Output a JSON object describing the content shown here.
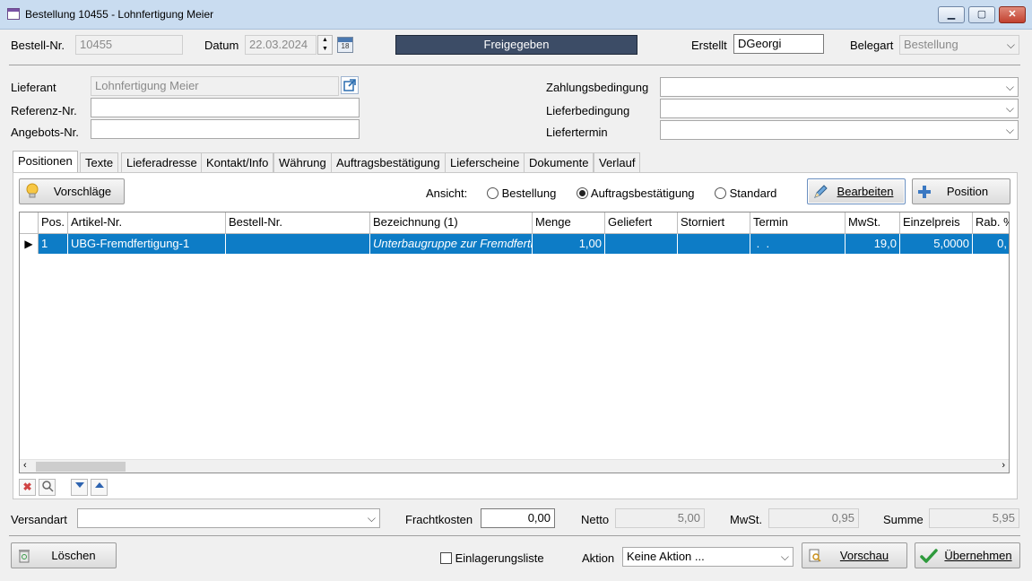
{
  "window": {
    "title": "Bestellung 10455 - Lohnfertigung Meier",
    "controls": {
      "minimize": "▁",
      "maximize": "▢",
      "close": "✕"
    }
  },
  "header": {
    "bestell_nr_label": "Bestell-Nr.",
    "bestell_nr_value": "10455",
    "datum_label": "Datum",
    "datum_value": "22.03.2024",
    "status": "Freigegeben",
    "erstellt_label": "Erstellt",
    "erstellt_value": "DGeorgi",
    "belegart_label": "Belegart",
    "belegart_value": "Bestellung"
  },
  "form": {
    "lieferant_label": "Lieferant",
    "lieferant_value": "Lohnfertigung Meier",
    "referenz_label": "Referenz-Nr.",
    "referenz_value": "",
    "angebots_label": "Angebots-Nr.",
    "angebots_value": "",
    "zahlung_label": "Zahlungsbedingung",
    "zahlung_value": "",
    "lieferbed_label": "Lieferbedingung",
    "lieferbed_value": "",
    "liefertermin_label": "Liefertermin",
    "liefertermin_value": ""
  },
  "tabs": [
    "Positionen",
    "Texte",
    "Lieferadresse",
    "Kontakt/Info",
    "Währung",
    "Auftragsbestätigung",
    "Lieferscheine",
    "Dokumente",
    "Verlauf"
  ],
  "toolbar": {
    "vorschlaege": "Vorschläge",
    "ansicht_label": "Ansicht:",
    "radio_bestellung": "Bestellung",
    "radio_auftrag": "Auftragsbestätigung",
    "radio_standard": "Standard",
    "selected_view": "Auftragsbestätigung",
    "bearbeiten": "Bearbeiten",
    "position": "Position"
  },
  "grid": {
    "columns": [
      "Pos.",
      "Artikel-Nr.",
      "Bestell-Nr.",
      "Bezeichnung (1)",
      "Menge",
      "Geliefert",
      "Storniert",
      "Termin",
      "MwSt.",
      "Einzelpreis",
      "Rab. %"
    ],
    "rows": [
      [
        "1",
        "UBG-Fremdfertigung-1",
        "",
        "Unterbaugruppe zur Fremdfertigung",
        "1,00",
        "",
        "",
        " .  .",
        "19,0",
        "5,0000",
        "0,"
      ]
    ],
    "row_marker": "▶"
  },
  "footer": {
    "versandart_label": "Versandart",
    "versandart_value": "",
    "frachtkosten_label": "Frachtkosten",
    "frachtkosten_value": "0,00",
    "netto_label": "Netto",
    "netto_value": "5,00",
    "mwst_label": "MwSt.",
    "mwst_value": "0,95",
    "summe_label": "Summe",
    "summe_value": "5,95",
    "loeschen": "Löschen",
    "einlagerung_label": "Einlagerungsliste",
    "aktion_label": "Aktion",
    "aktion_value": "Keine Aktion ...",
    "vorschau": "Vorschau",
    "uebernehmen": "Übernehmen"
  },
  "colors": {
    "status_bg": "#3c4c66",
    "selection": "#0d7cc6",
    "titlebar": "#c9dcf0"
  }
}
